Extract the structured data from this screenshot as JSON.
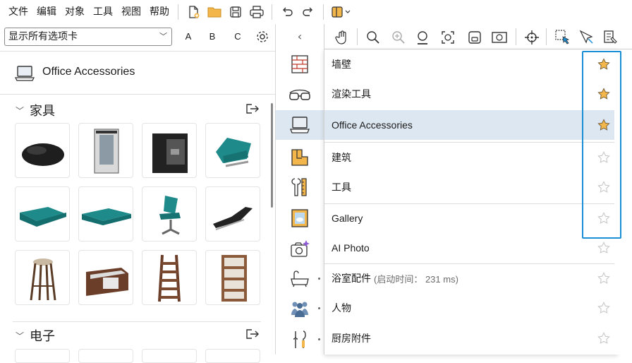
{
  "menu": [
    "文件",
    "编辑",
    "对象",
    "工具",
    "视图",
    "帮助"
  ],
  "left": {
    "category_select": "显示所有选项卡",
    "letters": [
      "A",
      "B",
      "C"
    ],
    "library_title": "Office Accessories",
    "sections": [
      {
        "title": "家具"
      },
      {
        "title": "电子"
      }
    ]
  },
  "panel": {
    "collapse_glyph": "‹",
    "items": [
      {
        "label": "墙壁",
        "note": "",
        "starred": true
      },
      {
        "label": "渲染工具",
        "note": "",
        "starred": true
      },
      {
        "label": "Office Accessories",
        "note": "",
        "starred": true
      },
      {
        "label": "建筑",
        "note": "",
        "starred": false
      },
      {
        "label": "工具",
        "note": "",
        "starred": false
      },
      {
        "label": "Gallery",
        "note": "",
        "starred": false
      },
      {
        "label": "AI Photo",
        "note": "",
        "starred": false
      },
      {
        "label": "浴室配件",
        "note": "(启动时间： 231 ms)",
        "starred": false
      },
      {
        "label": "人物",
        "note": "",
        "starred": false
      },
      {
        "label": "厨房附件",
        "note": "",
        "starred": false
      }
    ]
  },
  "colors": {
    "accent": "#1a8fd6",
    "star_filled": "#f3b64a",
    "star_empty": "#c8c8c8",
    "selection": "#dde7f1"
  }
}
